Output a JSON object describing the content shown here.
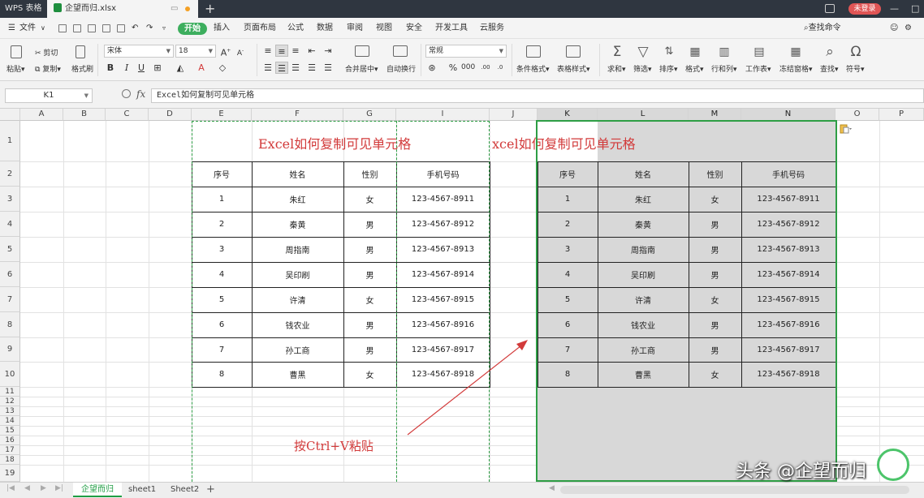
{
  "titlebar": {
    "app_label": "WPS 表格",
    "doc_title": "企望而归.xlsx",
    "login_label": "未登录"
  },
  "menubar": {
    "file_label": "文件",
    "items": [
      "开始",
      "插入",
      "页面布局",
      "公式",
      "数据",
      "审阅",
      "视图",
      "安全",
      "开发工具",
      "云服务"
    ],
    "search_label": "查找命令"
  },
  "ribbon": {
    "paste": "粘贴",
    "cut": "剪切",
    "copy": "复制",
    "format_painter": "格式刷",
    "font_name": "宋体",
    "font_size": "18",
    "number_format": "常规",
    "merge_center": "合并居中",
    "wrap_text": "自动换行",
    "cond_format": "条件格式",
    "table_style": "表格样式",
    "sum": "求和",
    "filter": "筛选",
    "sort": "排序",
    "format": "格式",
    "row_col": "行和列",
    "worksheet": "工作表",
    "freeze": "冻结窗格",
    "find": "查找",
    "symbol": "符号"
  },
  "formula_bar": {
    "name_box": "K1",
    "fx": "fx",
    "content": "Excel如何复制可见单元格"
  },
  "columns": [
    "A",
    "B",
    "C",
    "D",
    "E",
    "F",
    "G",
    "I",
    "J",
    "K",
    "L",
    "M",
    "N",
    "O",
    "P"
  ],
  "rows": [
    "1",
    "2",
    "3",
    "4",
    "5",
    "6",
    "7",
    "8",
    "9",
    "10",
    "11",
    "12",
    "13",
    "14",
    "15",
    "16",
    "17",
    "18",
    "19"
  ],
  "source_table": {
    "title": "Excel如何复制可见单元格",
    "headers": [
      "序号",
      "姓名",
      "性别",
      "手机号码"
    ],
    "rows": [
      [
        "1",
        "朱红",
        "女",
        "123-4567-8911"
      ],
      [
        "2",
        "秦黄",
        "男",
        "123-4567-8912"
      ],
      [
        "3",
        "周指南",
        "男",
        "123-4567-8913"
      ],
      [
        "4",
        "吴印刷",
        "男",
        "123-4567-8914"
      ],
      [
        "5",
        "许清",
        "女",
        "123-4567-8915"
      ],
      [
        "6",
        "钱农业",
        "男",
        "123-4567-8916"
      ],
      [
        "7",
        "孙工商",
        "男",
        "123-4567-8917"
      ],
      [
        "8",
        "曹黑",
        "女",
        "123-4567-8918"
      ]
    ]
  },
  "pasted_table": {
    "title_overflow": "xcel如何复制可见单元格",
    "headers": [
      "序号",
      "姓名",
      "性别",
      "手机号码"
    ],
    "rows": [
      [
        "1",
        "朱红",
        "女",
        "123-4567-8911"
      ],
      [
        "2",
        "秦黄",
        "男",
        "123-4567-8912"
      ],
      [
        "3",
        "周指南",
        "男",
        "123-4567-8913"
      ],
      [
        "4",
        "吴印刷",
        "男",
        "123-4567-8914"
      ],
      [
        "5",
        "许清",
        "女",
        "123-4567-8915"
      ],
      [
        "6",
        "钱农业",
        "男",
        "123-4567-8916"
      ],
      [
        "7",
        "孙工商",
        "男",
        "123-4567-8917"
      ],
      [
        "8",
        "曹黑",
        "女",
        "123-4567-8918"
      ]
    ]
  },
  "annotation": "按Ctrl+V粘贴",
  "sheets": [
    "企望而归",
    "sheet1",
    "Sheet2"
  ],
  "watermark": "头条 @企望而归",
  "colors": {
    "accent_green": "#3dae5e",
    "title_red": "#d23a3a",
    "login_red": "#e05555"
  }
}
